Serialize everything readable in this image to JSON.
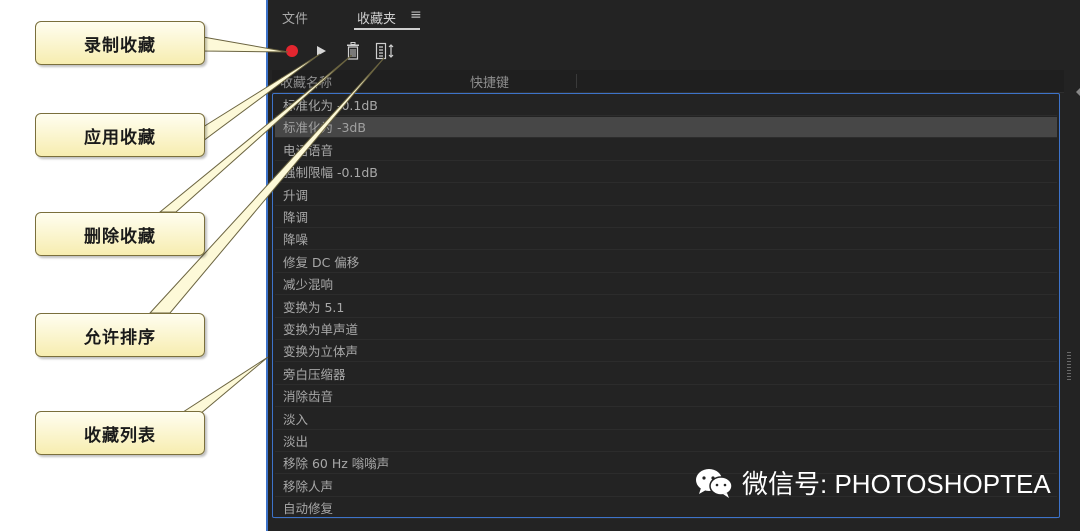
{
  "tabs": {
    "files": "文件",
    "favorites": "收藏夹",
    "menu_glyph": "≡"
  },
  "toolbar": {
    "record_icon": "record-icon",
    "play_icon": "play-icon",
    "trash_icon": "trash-icon",
    "sort_icon": "sort-icon",
    "record_color": "#e3262f"
  },
  "columns": {
    "name": "收藏名称",
    "shortcut": "快捷键"
  },
  "favorites": [
    "标准化为 -0.1dB",
    "标准化为 -3dB",
    "电话语音",
    "强制限幅 -0.1dB",
    "升调",
    "降调",
    "降噪",
    "修复 DC 偏移",
    "减少混响",
    "变换为 5.1",
    "变换为单声道",
    "变换为立体声",
    "旁白压缩器",
    "消除齿音",
    "淡入",
    "淡出",
    "移除 60 Hz 嗡嗡声",
    "移除人声",
    "自动修复"
  ],
  "selected_index": 1,
  "callouts": {
    "record": "录制收藏",
    "apply": "应用收藏",
    "delete": "删除收藏",
    "sort": "允许排序",
    "list": "收藏列表"
  },
  "watermark": {
    "text": "微信号: PHOTOSHOPTEA",
    "icon": "wechat-icon"
  },
  "colors": {
    "panel_bg": "#232323",
    "accent_border": "#3d73c9",
    "callout_fill": "#f7edb0"
  }
}
